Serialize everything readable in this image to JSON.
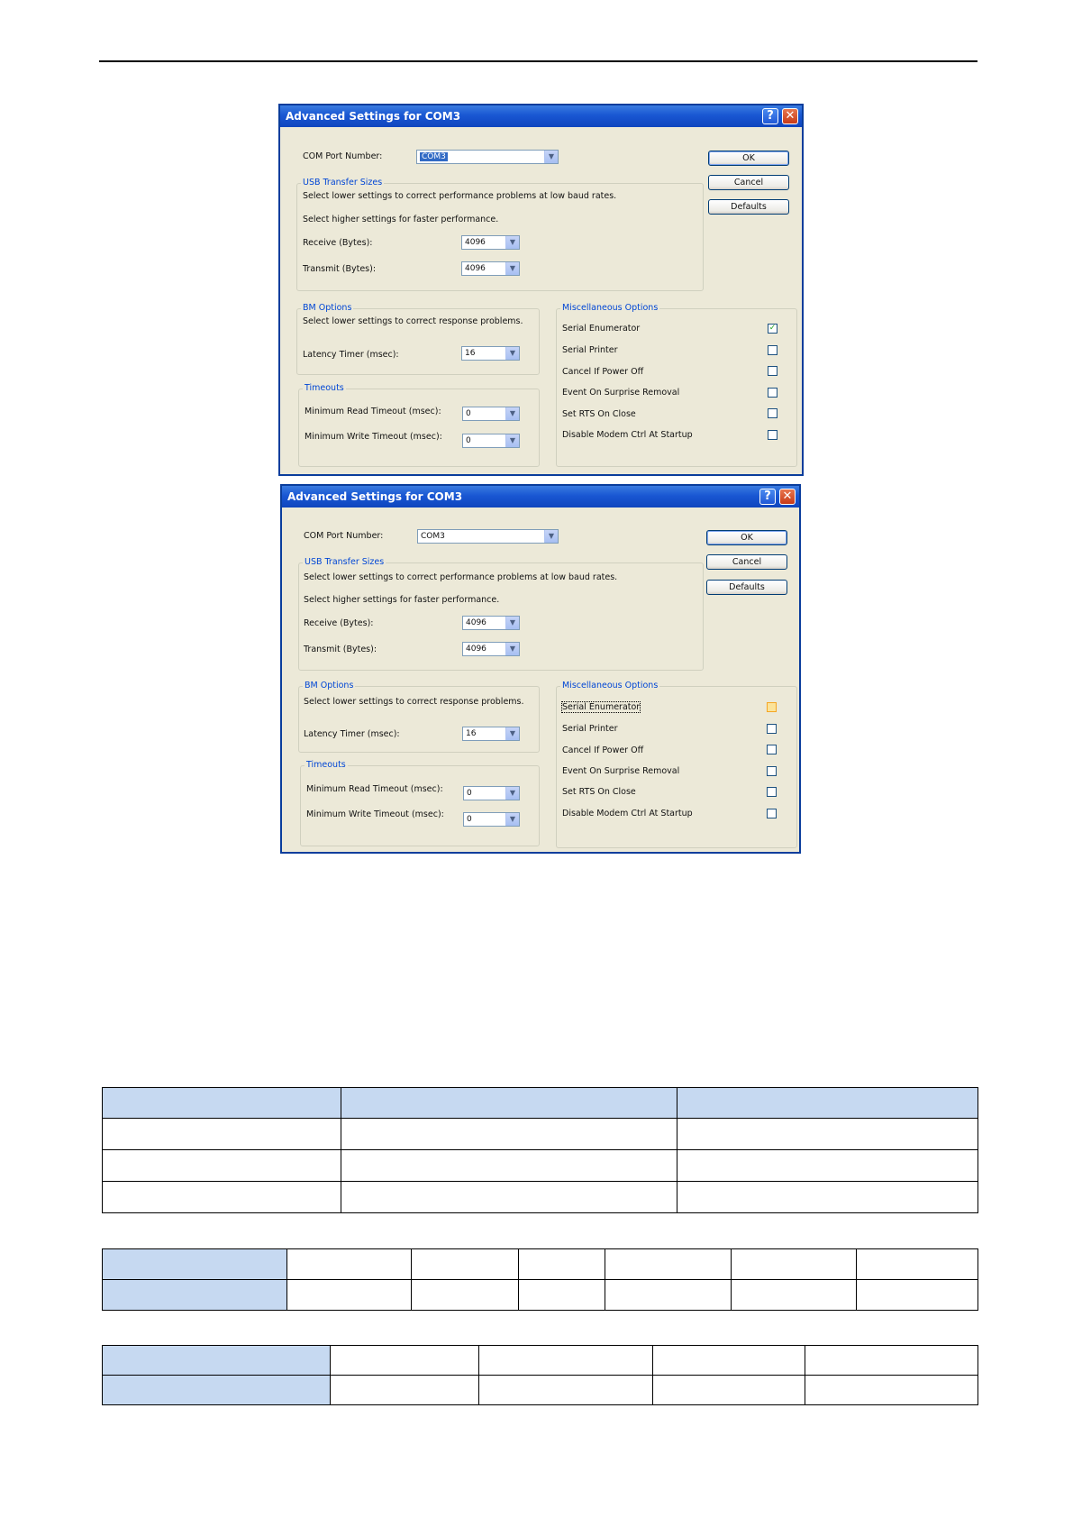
{
  "dialogs": [
    {
      "title": "Advanced Settings for COM3",
      "help_glyph": "?",
      "close_glyph": "✕",
      "com_port_label": "COM Port Number:",
      "com_port_value": "COM3",
      "buttons": {
        "ok": "OK",
        "cancel": "Cancel",
        "defaults": "Defaults"
      },
      "usb": {
        "legend": "USB Transfer Sizes",
        "note1": "Select lower settings to correct performance problems at low baud rates.",
        "note2": "Select higher settings for faster performance.",
        "receive_label": "Receive (Bytes):",
        "receive_value": "4096",
        "transmit_label": "Transmit (Bytes):",
        "transmit_value": "4096"
      },
      "bm": {
        "legend": "BM Options",
        "note": "Select lower settings to correct response problems.",
        "latency_label": "Latency Timer (msec):",
        "latency_value": "16"
      },
      "timeouts": {
        "legend": "Timeouts",
        "read_label": "Minimum Read Timeout (msec):",
        "read_value": "0",
        "write_label": "Minimum Write Timeout (msec):",
        "write_value": "0"
      },
      "misc": {
        "legend": "Miscellaneous Options",
        "options": [
          {
            "label": "Serial Enumerator",
            "checked": true,
            "mark": "✓"
          },
          {
            "label": "Serial Printer",
            "checked": false
          },
          {
            "label": "Cancel If Power Off",
            "checked": false
          },
          {
            "label": "Event On Surprise Removal",
            "checked": false
          },
          {
            "label": "Set RTS On Close",
            "checked": false
          },
          {
            "label": "Disable Modem Ctrl At Startup",
            "checked": false
          }
        ]
      }
    },
    {
      "title": "Advanced Settings for COM3",
      "help_glyph": "?",
      "close_glyph": "✕",
      "com_port_label": "COM Port Number:",
      "com_port_value": "COM3",
      "buttons": {
        "ok": "OK",
        "cancel": "Cancel",
        "defaults": "Defaults"
      },
      "usb": {
        "legend": "USB Transfer Sizes",
        "note1": "Select lower settings to correct performance problems at low baud rates.",
        "note2": "Select higher settings for faster performance.",
        "receive_label": "Receive (Bytes):",
        "receive_value": "4096",
        "transmit_label": "Transmit (Bytes):",
        "transmit_value": "4096"
      },
      "bm": {
        "legend": "BM Options",
        "note": "Select lower settings to correct response problems.",
        "latency_label": "Latency Timer (msec):",
        "latency_value": "16"
      },
      "timeouts": {
        "legend": "Timeouts",
        "read_label": "Minimum Read Timeout (msec):",
        "read_value": "0",
        "write_label": "Minimum Write Timeout (msec):",
        "write_value": "0"
      },
      "misc": {
        "legend": "Miscellaneous Options",
        "options": [
          {
            "label": "Serial Enumerator",
            "checked": false,
            "highlighted": true
          },
          {
            "label": "Serial Printer",
            "checked": false
          },
          {
            "label": "Cancel If Power Off",
            "checked": false
          },
          {
            "label": "Event On Surprise Removal",
            "checked": false
          },
          {
            "label": "Set RTS On Close",
            "checked": false
          },
          {
            "label": "Disable Modem Ctrl At Startup",
            "checked": false
          }
        ]
      }
    }
  ],
  "colors": {
    "table_header": "#c6d9f1",
    "title_bar": "#1957d3",
    "group_legend": "#0046d5"
  }
}
